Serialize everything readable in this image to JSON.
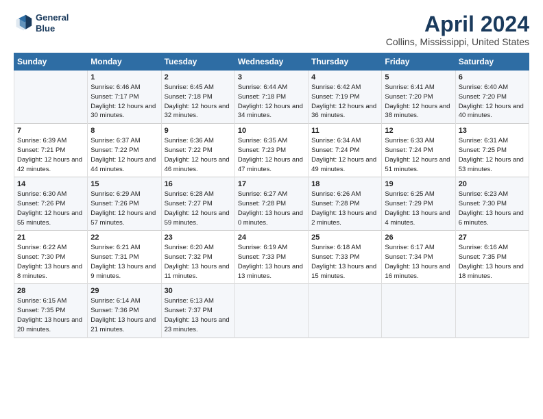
{
  "header": {
    "logo_line1": "General",
    "logo_line2": "Blue",
    "title": "April 2024",
    "subtitle": "Collins, Mississippi, United States"
  },
  "days_of_week": [
    "Sunday",
    "Monday",
    "Tuesday",
    "Wednesday",
    "Thursday",
    "Friday",
    "Saturday"
  ],
  "rows": [
    [
      {
        "day": "",
        "sunrise": "",
        "sunset": "",
        "daylight": ""
      },
      {
        "day": "1",
        "sunrise": "Sunrise: 6:46 AM",
        "sunset": "Sunset: 7:17 PM",
        "daylight": "Daylight: 12 hours and 30 minutes."
      },
      {
        "day": "2",
        "sunrise": "Sunrise: 6:45 AM",
        "sunset": "Sunset: 7:18 PM",
        "daylight": "Daylight: 12 hours and 32 minutes."
      },
      {
        "day": "3",
        "sunrise": "Sunrise: 6:44 AM",
        "sunset": "Sunset: 7:18 PM",
        "daylight": "Daylight: 12 hours and 34 minutes."
      },
      {
        "day": "4",
        "sunrise": "Sunrise: 6:42 AM",
        "sunset": "Sunset: 7:19 PM",
        "daylight": "Daylight: 12 hours and 36 minutes."
      },
      {
        "day": "5",
        "sunrise": "Sunrise: 6:41 AM",
        "sunset": "Sunset: 7:20 PM",
        "daylight": "Daylight: 12 hours and 38 minutes."
      },
      {
        "day": "6",
        "sunrise": "Sunrise: 6:40 AM",
        "sunset": "Sunset: 7:20 PM",
        "daylight": "Daylight: 12 hours and 40 minutes."
      }
    ],
    [
      {
        "day": "7",
        "sunrise": "Sunrise: 6:39 AM",
        "sunset": "Sunset: 7:21 PM",
        "daylight": "Daylight: 12 hours and 42 minutes."
      },
      {
        "day": "8",
        "sunrise": "Sunrise: 6:37 AM",
        "sunset": "Sunset: 7:22 PM",
        "daylight": "Daylight: 12 hours and 44 minutes."
      },
      {
        "day": "9",
        "sunrise": "Sunrise: 6:36 AM",
        "sunset": "Sunset: 7:22 PM",
        "daylight": "Daylight: 12 hours and 46 minutes."
      },
      {
        "day": "10",
        "sunrise": "Sunrise: 6:35 AM",
        "sunset": "Sunset: 7:23 PM",
        "daylight": "Daylight: 12 hours and 47 minutes."
      },
      {
        "day": "11",
        "sunrise": "Sunrise: 6:34 AM",
        "sunset": "Sunset: 7:24 PM",
        "daylight": "Daylight: 12 hours and 49 minutes."
      },
      {
        "day": "12",
        "sunrise": "Sunrise: 6:33 AM",
        "sunset": "Sunset: 7:24 PM",
        "daylight": "Daylight: 12 hours and 51 minutes."
      },
      {
        "day": "13",
        "sunrise": "Sunrise: 6:31 AM",
        "sunset": "Sunset: 7:25 PM",
        "daylight": "Daylight: 12 hours and 53 minutes."
      }
    ],
    [
      {
        "day": "14",
        "sunrise": "Sunrise: 6:30 AM",
        "sunset": "Sunset: 7:26 PM",
        "daylight": "Daylight: 12 hours and 55 minutes."
      },
      {
        "day": "15",
        "sunrise": "Sunrise: 6:29 AM",
        "sunset": "Sunset: 7:26 PM",
        "daylight": "Daylight: 12 hours and 57 minutes."
      },
      {
        "day": "16",
        "sunrise": "Sunrise: 6:28 AM",
        "sunset": "Sunset: 7:27 PM",
        "daylight": "Daylight: 12 hours and 59 minutes."
      },
      {
        "day": "17",
        "sunrise": "Sunrise: 6:27 AM",
        "sunset": "Sunset: 7:28 PM",
        "daylight": "Daylight: 13 hours and 0 minutes."
      },
      {
        "day": "18",
        "sunrise": "Sunrise: 6:26 AM",
        "sunset": "Sunset: 7:28 PM",
        "daylight": "Daylight: 13 hours and 2 minutes."
      },
      {
        "day": "19",
        "sunrise": "Sunrise: 6:25 AM",
        "sunset": "Sunset: 7:29 PM",
        "daylight": "Daylight: 13 hours and 4 minutes."
      },
      {
        "day": "20",
        "sunrise": "Sunrise: 6:23 AM",
        "sunset": "Sunset: 7:30 PM",
        "daylight": "Daylight: 13 hours and 6 minutes."
      }
    ],
    [
      {
        "day": "21",
        "sunrise": "Sunrise: 6:22 AM",
        "sunset": "Sunset: 7:30 PM",
        "daylight": "Daylight: 13 hours and 8 minutes."
      },
      {
        "day": "22",
        "sunrise": "Sunrise: 6:21 AM",
        "sunset": "Sunset: 7:31 PM",
        "daylight": "Daylight: 13 hours and 9 minutes."
      },
      {
        "day": "23",
        "sunrise": "Sunrise: 6:20 AM",
        "sunset": "Sunset: 7:32 PM",
        "daylight": "Daylight: 13 hours and 11 minutes."
      },
      {
        "day": "24",
        "sunrise": "Sunrise: 6:19 AM",
        "sunset": "Sunset: 7:33 PM",
        "daylight": "Daylight: 13 hours and 13 minutes."
      },
      {
        "day": "25",
        "sunrise": "Sunrise: 6:18 AM",
        "sunset": "Sunset: 7:33 PM",
        "daylight": "Daylight: 13 hours and 15 minutes."
      },
      {
        "day": "26",
        "sunrise": "Sunrise: 6:17 AM",
        "sunset": "Sunset: 7:34 PM",
        "daylight": "Daylight: 13 hours and 16 minutes."
      },
      {
        "day": "27",
        "sunrise": "Sunrise: 6:16 AM",
        "sunset": "Sunset: 7:35 PM",
        "daylight": "Daylight: 13 hours and 18 minutes."
      }
    ],
    [
      {
        "day": "28",
        "sunrise": "Sunrise: 6:15 AM",
        "sunset": "Sunset: 7:35 PM",
        "daylight": "Daylight: 13 hours and 20 minutes."
      },
      {
        "day": "29",
        "sunrise": "Sunrise: 6:14 AM",
        "sunset": "Sunset: 7:36 PM",
        "daylight": "Daylight: 13 hours and 21 minutes."
      },
      {
        "day": "30",
        "sunrise": "Sunrise: 6:13 AM",
        "sunset": "Sunset: 7:37 PM",
        "daylight": "Daylight: 13 hours and 23 minutes."
      },
      {
        "day": "",
        "sunrise": "",
        "sunset": "",
        "daylight": ""
      },
      {
        "day": "",
        "sunrise": "",
        "sunset": "",
        "daylight": ""
      },
      {
        "day": "",
        "sunrise": "",
        "sunset": "",
        "daylight": ""
      },
      {
        "day": "",
        "sunrise": "",
        "sunset": "",
        "daylight": ""
      }
    ]
  ]
}
